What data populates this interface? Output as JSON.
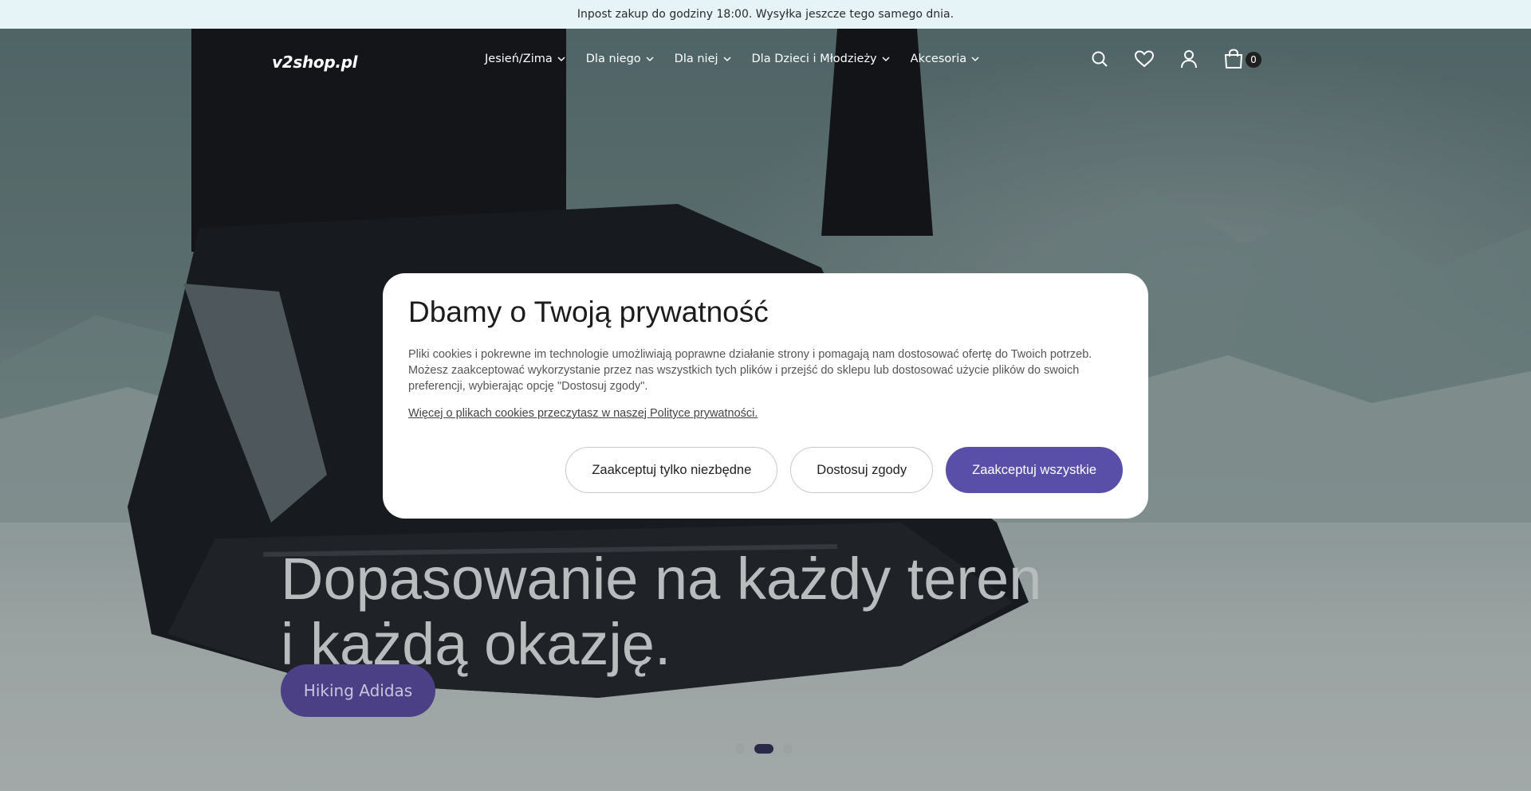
{
  "announcement": "Inpost zakup do godziny 18:00. Wysyłka jeszcze tego samego dnia.",
  "header": {
    "logo": "v2shop.pl",
    "nav": [
      {
        "label": "Jesień/Zima"
      },
      {
        "label": "Dla niego"
      },
      {
        "label": "Dla niej"
      },
      {
        "label": "Dla Dzieci i Młodzieży"
      },
      {
        "label": "Akcesoria"
      }
    ],
    "icons": [
      "search-icon",
      "heart-icon",
      "user-icon",
      "cart-icon"
    ],
    "cart_count": "0"
  },
  "hero": {
    "headline_line1": "Dopasowanie na każdy teren",
    "headline_line2": "i każdą okazję.",
    "cta_label": "Hiking Adidas",
    "slides_total": 3,
    "active_slide": 2
  },
  "cookie_modal": {
    "title": "Dbamy o Twoją prywatność",
    "body": "Pliki cookies i pokrewne im technologie umożliwiają poprawne działanie strony i pomagają nam dostosować ofertę do Twoich potrzeb. Możesz zaakceptować wykorzystanie przez nas wszystkich tych plików i przejść do sklepu lub dostosować użycie plików do swoich preferencji, wybierając opcję \"Dostosuj zgody\".",
    "link": "Więcej o plikach cookies przeczytasz w naszej Polityce prywatności.",
    "buttons": {
      "necessary": "Zaakceptuj tylko niezbędne",
      "customize": "Dostosuj zgody",
      "accept_all": "Zaakceptuj wszystkie"
    }
  },
  "colors": {
    "accent": "#5a4fa8",
    "announcement_bg": "#e6f4f8"
  }
}
